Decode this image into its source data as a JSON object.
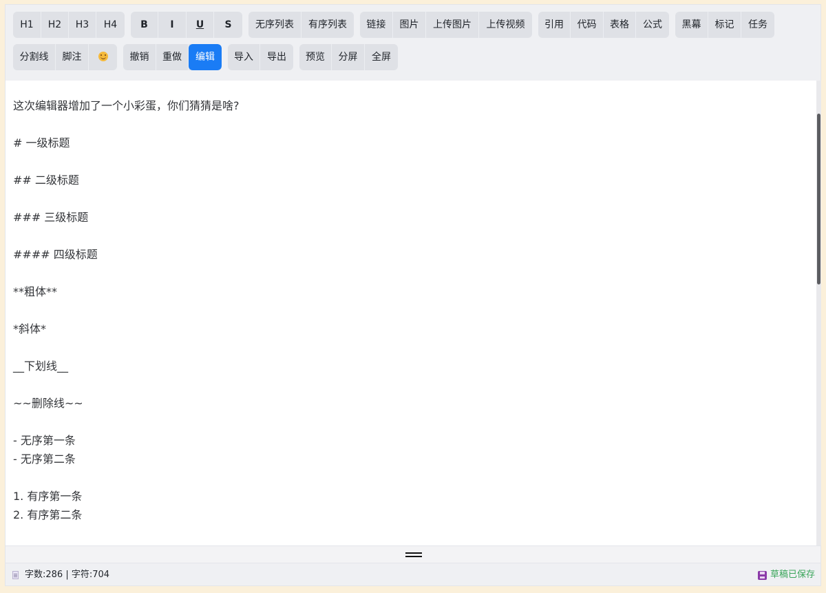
{
  "toolbar": {
    "row1": {
      "headings": [
        "H1",
        "H2",
        "H3",
        "H4"
      ],
      "format": [
        "B",
        "I",
        "U",
        "S"
      ],
      "lists": [
        "无序列表",
        "有序列表"
      ],
      "insert": [
        "链接",
        "图片",
        "上传图片",
        "上传视频"
      ],
      "blocks": [
        "引用",
        "代码",
        "表格",
        "公式"
      ],
      "extra": [
        "黑幕",
        "标记",
        "任务"
      ]
    },
    "row2": {
      "misc": [
        "分割线",
        "脚注"
      ],
      "history": [
        "撤销",
        "重做",
        "编辑"
      ],
      "io": [
        "导入",
        "导出"
      ],
      "view": [
        "预览",
        "分屏",
        "全屏"
      ]
    },
    "active_button": "编辑",
    "emoji_icon": "smiley-emoji-icon"
  },
  "content": {
    "lines": [
      "这次编辑器增加了一个小彩蛋，你们猜猜是啥?",
      "",
      "# 一级标题",
      "",
      "## 二级标题",
      "",
      "### 三级标题",
      "",
      "#### 四级标题",
      "",
      "**粗体**",
      "",
      "*斜体*",
      "",
      "__下划线__",
      "",
      "~~删除线~~",
      "",
      "- 无序第一条",
      "- 无序第二条",
      "",
      "1. 有序第一条",
      "2. 有序第二条"
    ]
  },
  "status": {
    "counts": "字数:286 | 字符:704",
    "saved": "草稿已保存"
  },
  "colors": {
    "page_background": "#fbf0da",
    "toolbar_background": "#eff0f3",
    "button_group": "#dfe1e6",
    "active_accent": "#1a7cf5",
    "saved_text": "#3aa55a",
    "save_icon": "#8b3aa8"
  }
}
